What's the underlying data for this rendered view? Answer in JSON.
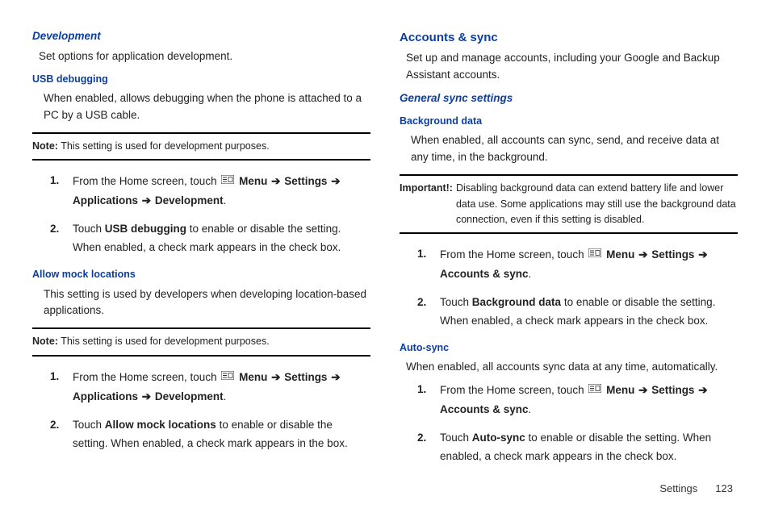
{
  "left": {
    "h_development": "Development",
    "dev_intro": "Set options for application development.",
    "h_usb": "USB debugging",
    "usb_body": "When enabled, allows debugging when the phone is attached to a PC by a USB cable.",
    "note1_label": "Note:",
    "note1_text": " This setting is used for development purposes.",
    "step1a_pre": "From the Home screen, touch ",
    "menu": "Menu",
    "settings": "Settings",
    "applications": "Applications",
    "development": "Development",
    "step1b_pre": "Touch ",
    "usb_debugging": "USB debugging",
    "step1b_post": " to enable or disable the setting. When enabled, a check mark appears in the check box.",
    "h_mock": "Allow mock locations",
    "mock_body": "This setting is used by developers when developing location-based applications.",
    "note2_label": "Note:",
    "note2_text": " This setting is used for development purposes.",
    "allow_mock": "Allow mock locations",
    "step2b_post": " to enable or disable the setting. When enabled, a check mark appears in the box."
  },
  "right": {
    "h_accounts": "Accounts & sync",
    "acc_intro": "Set up and manage accounts, including your Google and Backup Assistant accounts.",
    "h_general": "General sync settings",
    "h_bgdata": "Background data",
    "bg_body": "When enabled, all accounts can sync, send, and receive data at any time, in the background.",
    "imp_label": "Important!:",
    "imp_text": "Disabling background data can extend battery life and lower data use. Some applications may still use the background data connection, even if this setting is disabled.",
    "acc_sync": "Accounts & sync",
    "bg_data": "Background data",
    "bg_step_post": " to enable or disable the setting. When enabled, a check mark appears in the check box.",
    "h_autosync": "Auto-sync",
    "auto_body": "When enabled, all accounts sync data at any time, automatically.",
    "auto_sync": "Auto-sync",
    "auto_step_post": " to enable or disable the setting. When enabled, a check mark appears in the check box."
  },
  "footer": {
    "section": "Settings",
    "page": "123"
  },
  "arrow": "➔",
  "period": "."
}
